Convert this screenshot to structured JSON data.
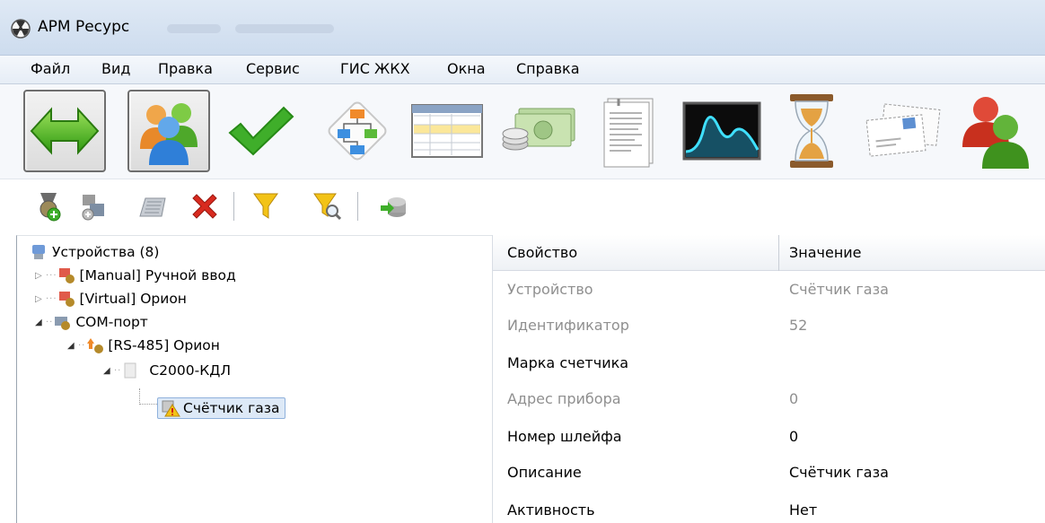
{
  "window": {
    "title": "АРМ Ресурс",
    "icon": "radiation-icon"
  },
  "menu": [
    "Файл",
    "Вид",
    "Правка",
    "Сервис",
    "ГИС ЖКХ",
    "Окна",
    "Справка"
  ],
  "big_toolbar": [
    {
      "icon": "connect-arrows-icon",
      "pressed": true
    },
    {
      "icon": "users-icon",
      "pressed": true
    },
    {
      "icon": "checkmark-icon",
      "pressed": false
    },
    {
      "icon": "diagram-icon",
      "pressed": false
    },
    {
      "icon": "table-icon",
      "pressed": false
    },
    {
      "icon": "money-icon",
      "pressed": false
    },
    {
      "icon": "document-icon",
      "pressed": false
    },
    {
      "icon": "chart-icon",
      "pressed": false
    },
    {
      "icon": "hourglass-icon",
      "pressed": false
    },
    {
      "icon": "mail-icon",
      "pressed": false
    },
    {
      "icon": "user-group-icon",
      "pressed": false
    }
  ],
  "small_toolbar": [
    "add-device-icon",
    "add-node-icon",
    "calculator-icon",
    "delete-icon",
    "filter-icon",
    "filter-search-icon",
    "import-icon"
  ],
  "tree": {
    "root": "Устройства (8)",
    "manual": "[Manual] Ручной ввод",
    "virtual": "[Virtual] Орион",
    "com_port": "COM-порт",
    "rs485": "[RS-485] Орион",
    "kdl": "С2000-КДЛ",
    "gas_meter": "Счётчик газа"
  },
  "properties": {
    "header_name": "Свойство",
    "header_value": "Значение",
    "rows": [
      {
        "name": "Устройство",
        "value": "Счётчик газа",
        "disabled": true
      },
      {
        "name": "Идентификатор",
        "value": "52",
        "disabled": true
      },
      {
        "name": "Марка счетчика",
        "value": "",
        "disabled": false
      },
      {
        "name": "Адрес прибора",
        "value": "0",
        "disabled": true
      },
      {
        "name": "Номер шлейфа",
        "value": "0",
        "disabled": false
      },
      {
        "name": "Описание",
        "value": "Счётчик газа",
        "disabled": false
      },
      {
        "name": "Активность",
        "value": "Нет",
        "disabled": false
      }
    ]
  },
  "colors": {
    "selection": "#dde9f7",
    "disabled_text": "#8f8f8f",
    "title_bg": "#dfe9f5"
  }
}
